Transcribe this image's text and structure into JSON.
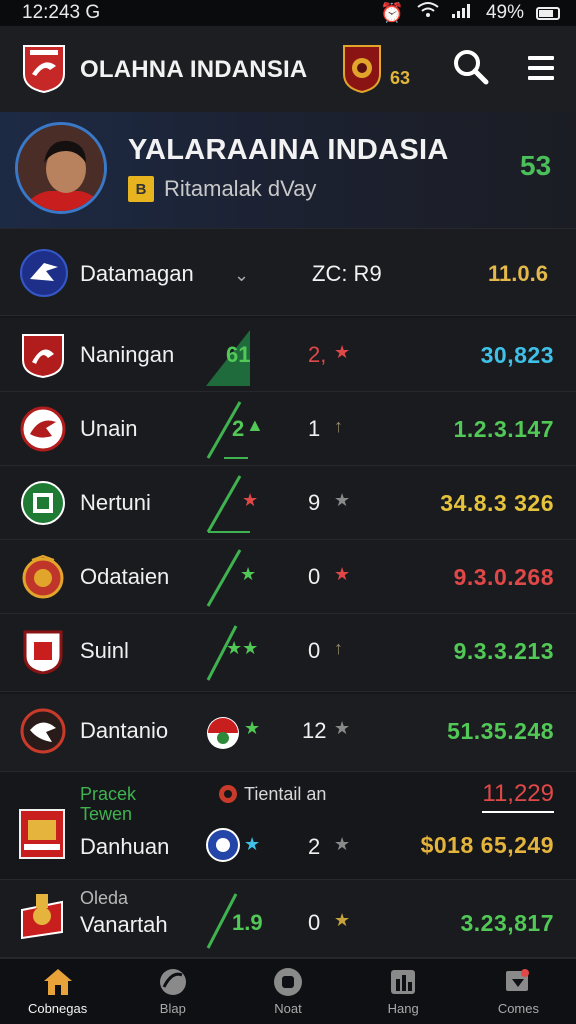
{
  "status": {
    "time": "12:243 G",
    "battery": "49%"
  },
  "header": {
    "title": "OLAHNA INDANSIA",
    "badge_num": "63"
  },
  "profile": {
    "title": "YALARAAINA INDASIA",
    "sub_icon": "B",
    "subtitle": "Ritamalak dVay",
    "score": "53"
  },
  "filter": {
    "label": "Datamagan",
    "mid": "ZC: R9",
    "value": "11.0.6"
  },
  "rows": [
    {
      "name": "Naningan",
      "c1": "61",
      "c2": "2,",
      "value": "30,823",
      "value_color": "#3fc0e6"
    },
    {
      "name": "Unain",
      "c1": "2",
      "c2": "1",
      "value": "1.2.3.147",
      "value_color": "#52c857"
    },
    {
      "name": "Nertuni",
      "c1": "",
      "c2": "9",
      "value": "34.8.3 326",
      "value_color": "#e5c33c"
    },
    {
      "name": "Odataien",
      "c1": "",
      "c2": "0",
      "value": "9.3.0.268",
      "value_color": "#e04848"
    },
    {
      "name": "Suinl",
      "c1": "",
      "c2": "0",
      "value": "9.3.3.213",
      "value_color": "#52c857"
    },
    {
      "name": "Dantanio",
      "c1": "",
      "c2": "12",
      "value": "51.35.248",
      "value_color": "#52c857"
    },
    {
      "name": "Danhuan",
      "c1": "",
      "c2": "2",
      "value": "$018 65,249",
      "value_color": "#e5b43c"
    },
    {
      "name": "Vanartah",
      "c1": "1.9",
      "c2": "0",
      "value": "3.23,817",
      "value_color": "#52c857"
    }
  ],
  "extra": {
    "green_label_1": "Pracek",
    "green_label_2": "Tewen",
    "mid_label": "Tientail an",
    "value": "11,229",
    "upper_label": "Oleda"
  },
  "nav": [
    {
      "label": "Cobnegas",
      "icon": "home-icon",
      "active": true
    },
    {
      "label": "Blap",
      "icon": "ball-icon",
      "active": false
    },
    {
      "label": "Noat",
      "icon": "chat-icon",
      "active": false
    },
    {
      "label": "Hang",
      "icon": "stats-icon",
      "active": false
    },
    {
      "label": "Comes",
      "icon": "flag-icon",
      "active": false
    }
  ],
  "colors": {
    "accent_green": "#52c857",
    "accent_gold": "#e5b43c",
    "accent_red": "#e04848",
    "accent_cyan": "#3fc0e6",
    "home_orange": "#e8a23a"
  }
}
